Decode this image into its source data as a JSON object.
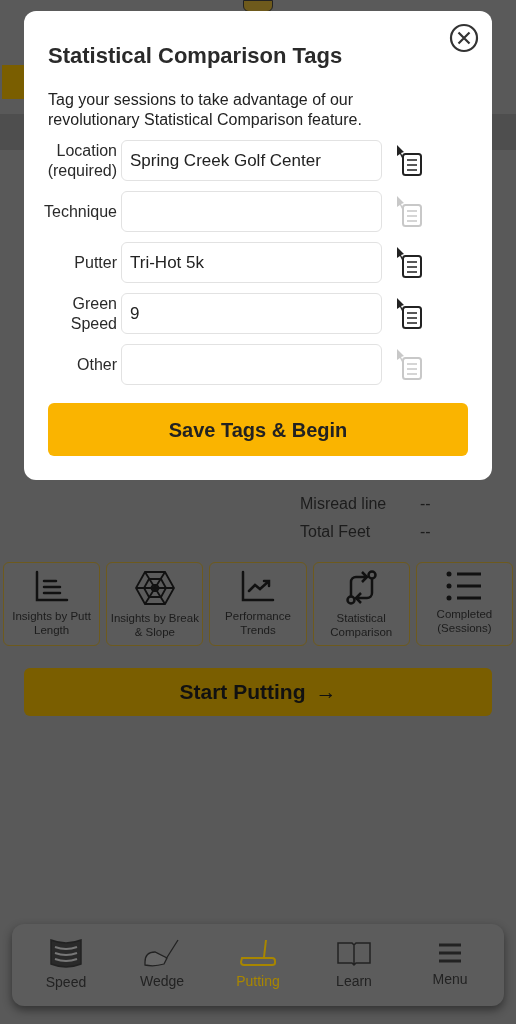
{
  "background": {
    "stats": [
      {
        "label": "Misread line",
        "value": "--"
      },
      {
        "label": "Total Feet",
        "value": "--"
      }
    ],
    "tiles": [
      {
        "kind": "length",
        "label": "Insights by Putt Length"
      },
      {
        "kind": "web",
        "label": "Insights by Break & Slope"
      },
      {
        "kind": "trend",
        "label": "Performance Trends"
      },
      {
        "kind": "compare",
        "label": "Statistical Comparison"
      },
      {
        "kind": "list",
        "label": "Completed (Sessions)"
      }
    ],
    "start_button": {
      "label": "Start Putting",
      "arrow": "→"
    },
    "tab_bar": [
      {
        "kind": "speed",
        "label": "Speed",
        "selected": false
      },
      {
        "kind": "wedge",
        "label": "Wedge",
        "selected": false
      },
      {
        "kind": "putter",
        "label": "Putting",
        "selected": true
      },
      {
        "kind": "book",
        "label": "Learn",
        "selected": false
      },
      {
        "kind": "menu",
        "label": "Menu",
        "selected": false
      }
    ]
  },
  "dialog": {
    "title": "Statistical Comparison Tags",
    "description": "Tag your sessions to take advantage of our revolutionary Statistical Comparison feature.",
    "fields": [
      {
        "label": "Location (required)",
        "value": "Spring Creek Golf Center",
        "picker_disabled": false
      },
      {
        "label": "Technique",
        "picker_disabled": true
      },
      {
        "label": "Putter",
        "value": "Tri-Hot 5k",
        "picker_disabled": false
      },
      {
        "label": "Green Speed",
        "value": "9",
        "picker_disabled": false
      },
      {
        "label": "Other",
        "picker_disabled": true
      }
    ],
    "save_button": "Save Tags & Begin"
  }
}
